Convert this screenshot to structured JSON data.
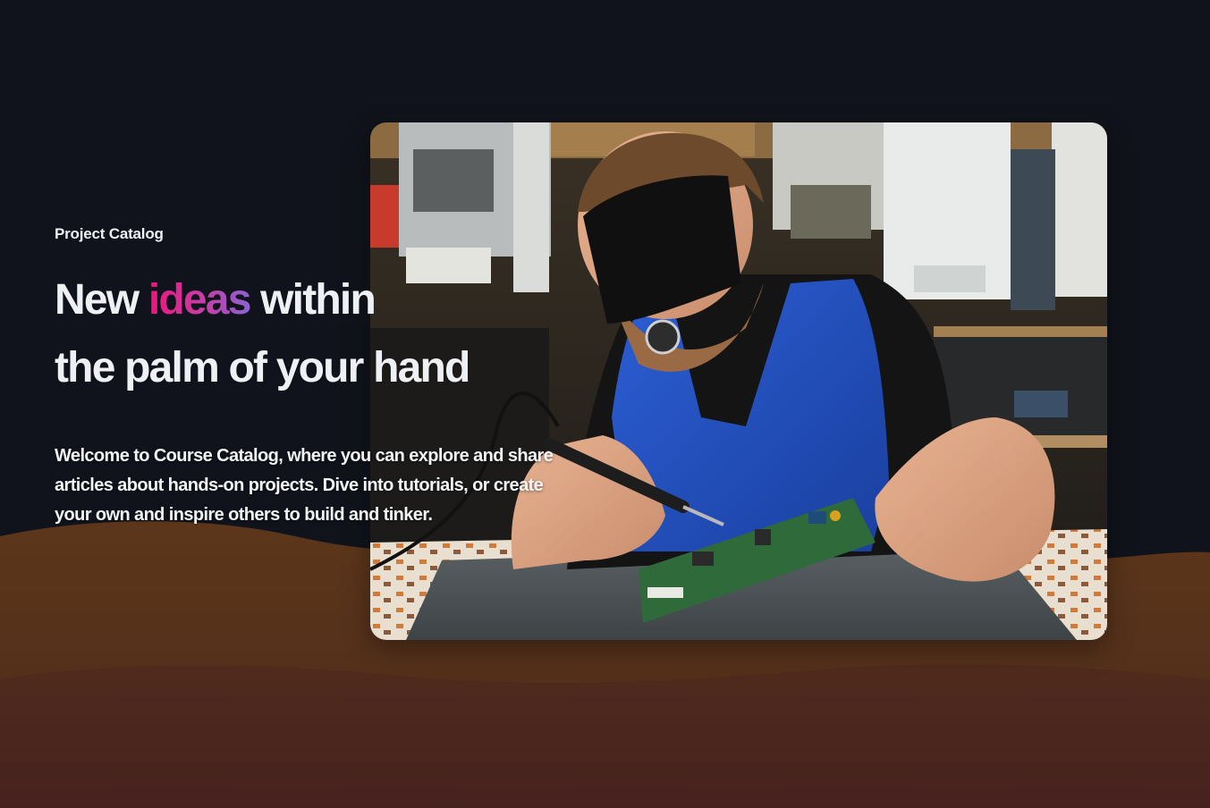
{
  "hero": {
    "eyebrow": "Project Catalog",
    "headline": {
      "line1_before": "New ",
      "line1_accent": "ideas",
      "line1_after": " within",
      "line2": "the palm of your hand"
    },
    "description": "Welcome to Course Catalog, where you can explore and share articles about hands-on projects. Dive into tutorials, or create your own and inspire others to build and tinker."
  },
  "colors": {
    "background": "#10131b",
    "wave_top": "#5a3519",
    "wave_bottom": "#4a2320",
    "accent_start": "#f0147d",
    "accent_end": "#8a63d2",
    "text": "#eef0f4"
  }
}
